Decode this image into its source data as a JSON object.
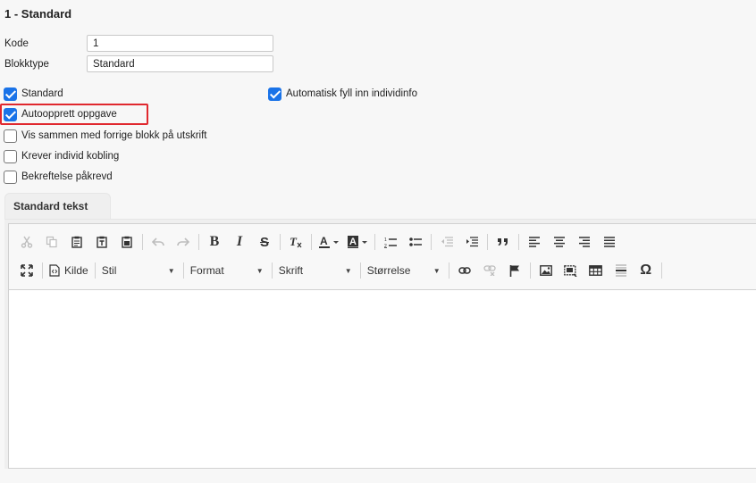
{
  "section": {
    "title": "1 - Standard"
  },
  "fields": {
    "kode": {
      "label": "Kode",
      "value": "1"
    },
    "blokktype": {
      "label": "Blokktype",
      "value": "Standard"
    }
  },
  "checkboxes": {
    "standard": {
      "label": "Standard",
      "checked": true
    },
    "auto_fill": {
      "label": "Automatisk fyll inn individinfo",
      "checked": true
    },
    "autoopprett": {
      "label": "Autoopprett oppgave",
      "checked": true
    },
    "vis_sammen": {
      "label": "Vis sammen med forrige blokk på utskrift",
      "checked": false
    },
    "krever_kobling": {
      "label": "Krever individ kobling",
      "checked": false
    },
    "bekreftelse": {
      "label": "Bekreftelse påkrevd",
      "checked": false
    }
  },
  "tab": {
    "label": "Standard tekst"
  },
  "toolbar": {
    "source_label": "Kilde",
    "combos": {
      "style": "Stil",
      "format": "Format",
      "font": "Skrift",
      "size": "Størrelse"
    },
    "icons": {
      "omega": "Ω"
    }
  },
  "colors": {
    "accent": "#1a73e8",
    "highlight": "#e0282e"
  }
}
